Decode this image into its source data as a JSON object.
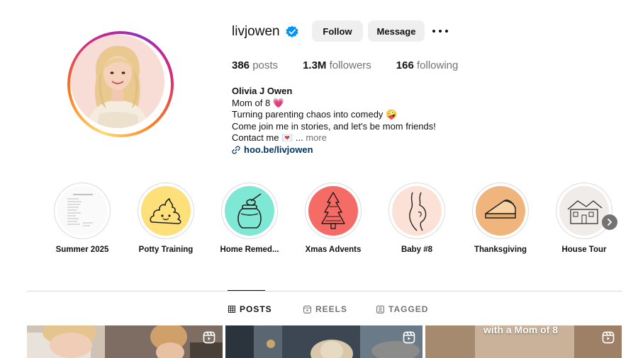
{
  "profile": {
    "username": "livjowen",
    "verified": true,
    "follow_label": "Follow",
    "message_label": "Message",
    "more_icon": "more-horizontal-icon",
    "stats": {
      "posts_value": "386",
      "posts_label": "posts",
      "followers_value": "1.3M",
      "followers_label": "followers",
      "following_value": "166",
      "following_label": "following"
    },
    "bio": {
      "name": "Olivia J Owen",
      "line1": "Mom of 8 💗",
      "line2": "Turning parenting chaos into comedy 🤪",
      "line3": "Come join me in stories, and let's be mom friends!",
      "line4": "Contact me 💌 ...",
      "more": "more",
      "link": "hoo.be/livjowen"
    }
  },
  "highlights": [
    {
      "label": "Summer 2025"
    },
    {
      "label": "Potty Training"
    },
    {
      "label": "Home Remed..."
    },
    {
      "label": "Xmas Advents"
    },
    {
      "label": "Baby #8"
    },
    {
      "label": "Thanksgiving"
    },
    {
      "label": "House Tour"
    }
  ],
  "tabs": {
    "posts": "POSTS",
    "reels": "REELS",
    "tagged": "TAGGED",
    "active": "posts"
  },
  "posts": [
    {
      "type": "reel"
    },
    {
      "type": "reel"
    },
    {
      "type": "reel",
      "caption": "with a Mom of 8"
    }
  ],
  "colors": {
    "verified_blue": "#0095f6",
    "button_bg": "#efefef",
    "link_blue": "#00376b",
    "muted_text": "#737373"
  }
}
